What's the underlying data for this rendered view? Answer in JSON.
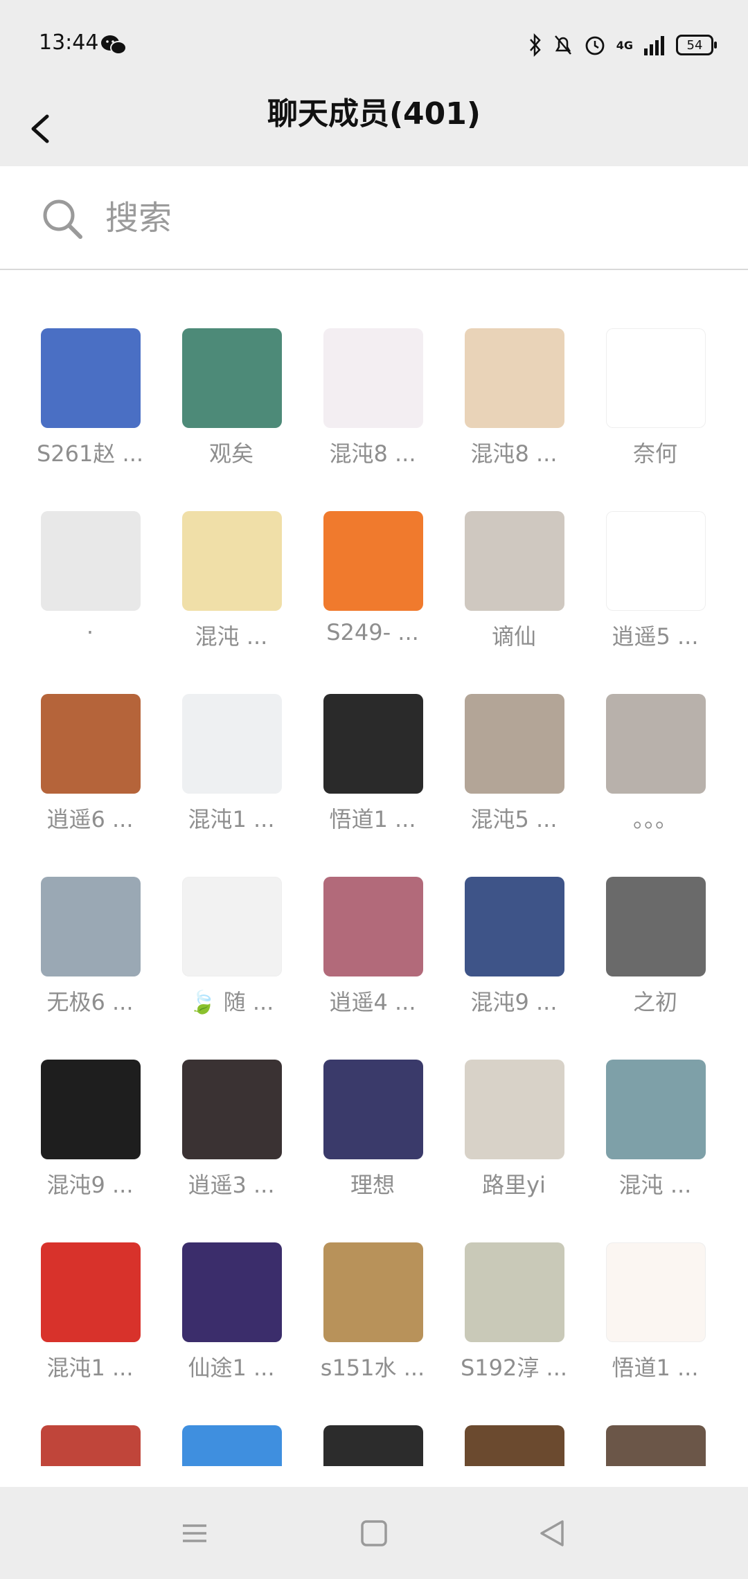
{
  "status": {
    "time": "13:44",
    "network": "4G",
    "battery": "54",
    "icons": [
      "wechat-icon",
      "bluetooth-icon",
      "mute-icon",
      "alarm-icon",
      "signal-icon",
      "battery-icon"
    ]
  },
  "header": {
    "title": "聊天成员(401)",
    "back_icon": "chevron-left-icon"
  },
  "search": {
    "placeholder": "搜索",
    "value": ""
  },
  "members": [
    {
      "name": "S261赵 ...",
      "color": "#4a6fc4"
    },
    {
      "name": "观矣",
      "color": "#4d8a78"
    },
    {
      "name": "混沌8 ...",
      "color": "#f3eef2"
    },
    {
      "name": "混沌8 ...",
      "color": "#e9d3b8"
    },
    {
      "name": "奈何",
      "color": "#ffffff"
    },
    {
      "name": "·",
      "color": "#e8e8e8"
    },
    {
      "name": "混沌 ...",
      "color": "#f0dfa8"
    },
    {
      "name": "S249- ...",
      "color": "#f07a2d"
    },
    {
      "name": "谪仙",
      "color": "#cfc8c0"
    },
    {
      "name": "逍遥5 ...",
      "color": "#ffffff"
    },
    {
      "name": "逍遥6 ...",
      "color": "#b5643a"
    },
    {
      "name": "混沌1 ...",
      "color": "#eef0f2"
    },
    {
      "name": "悟道1 ...",
      "color": "#2a2a2a"
    },
    {
      "name": "混沌5 ...",
      "color": "#b3a597"
    },
    {
      "name": "。。。",
      "color": "#b8b1ab"
    },
    {
      "name": "无极6 ...",
      "color": "#9aa8b4"
    },
    {
      "name": "🍃 随 ...",
      "color": "#f2f2f2"
    },
    {
      "name": "逍遥4 ...",
      "color": "#b26a7a"
    },
    {
      "name": "混沌9 ...",
      "color": "#3e5488"
    },
    {
      "name": "之初",
      "color": "#6a6a6a"
    },
    {
      "name": "混沌9 ...",
      "color": "#1e1e1e"
    },
    {
      "name": "逍遥3 ...",
      "color": "#3a3233"
    },
    {
      "name": "理想",
      "color": "#3a3a6a"
    },
    {
      "name": "路里yi",
      "color": "#d8d2c8"
    },
    {
      "name": "混沌 ...",
      "color": "#7ea0a8"
    },
    {
      "name": "混沌1 ...",
      "color": "#d8322b"
    },
    {
      "name": "仙途1 ...",
      "color": "#3b2d6b"
    },
    {
      "name": "s151水 ...",
      "color": "#b8925a"
    },
    {
      "name": "S192淳 ...",
      "color": "#c9c9b8"
    },
    {
      "name": "悟道1 ...",
      "color": "#fbf6f2"
    },
    {
      "name": "",
      "color": "#c0453a"
    },
    {
      "name": "",
      "color": "#3f8fdf"
    },
    {
      "name": "",
      "color": "#2c2c2c"
    },
    {
      "name": "",
      "color": "#6b4a2f"
    },
    {
      "name": "",
      "color": "#6b5648"
    }
  ],
  "bottom_nav": [
    "menu-icon",
    "home-icon",
    "back-triangle-icon"
  ]
}
